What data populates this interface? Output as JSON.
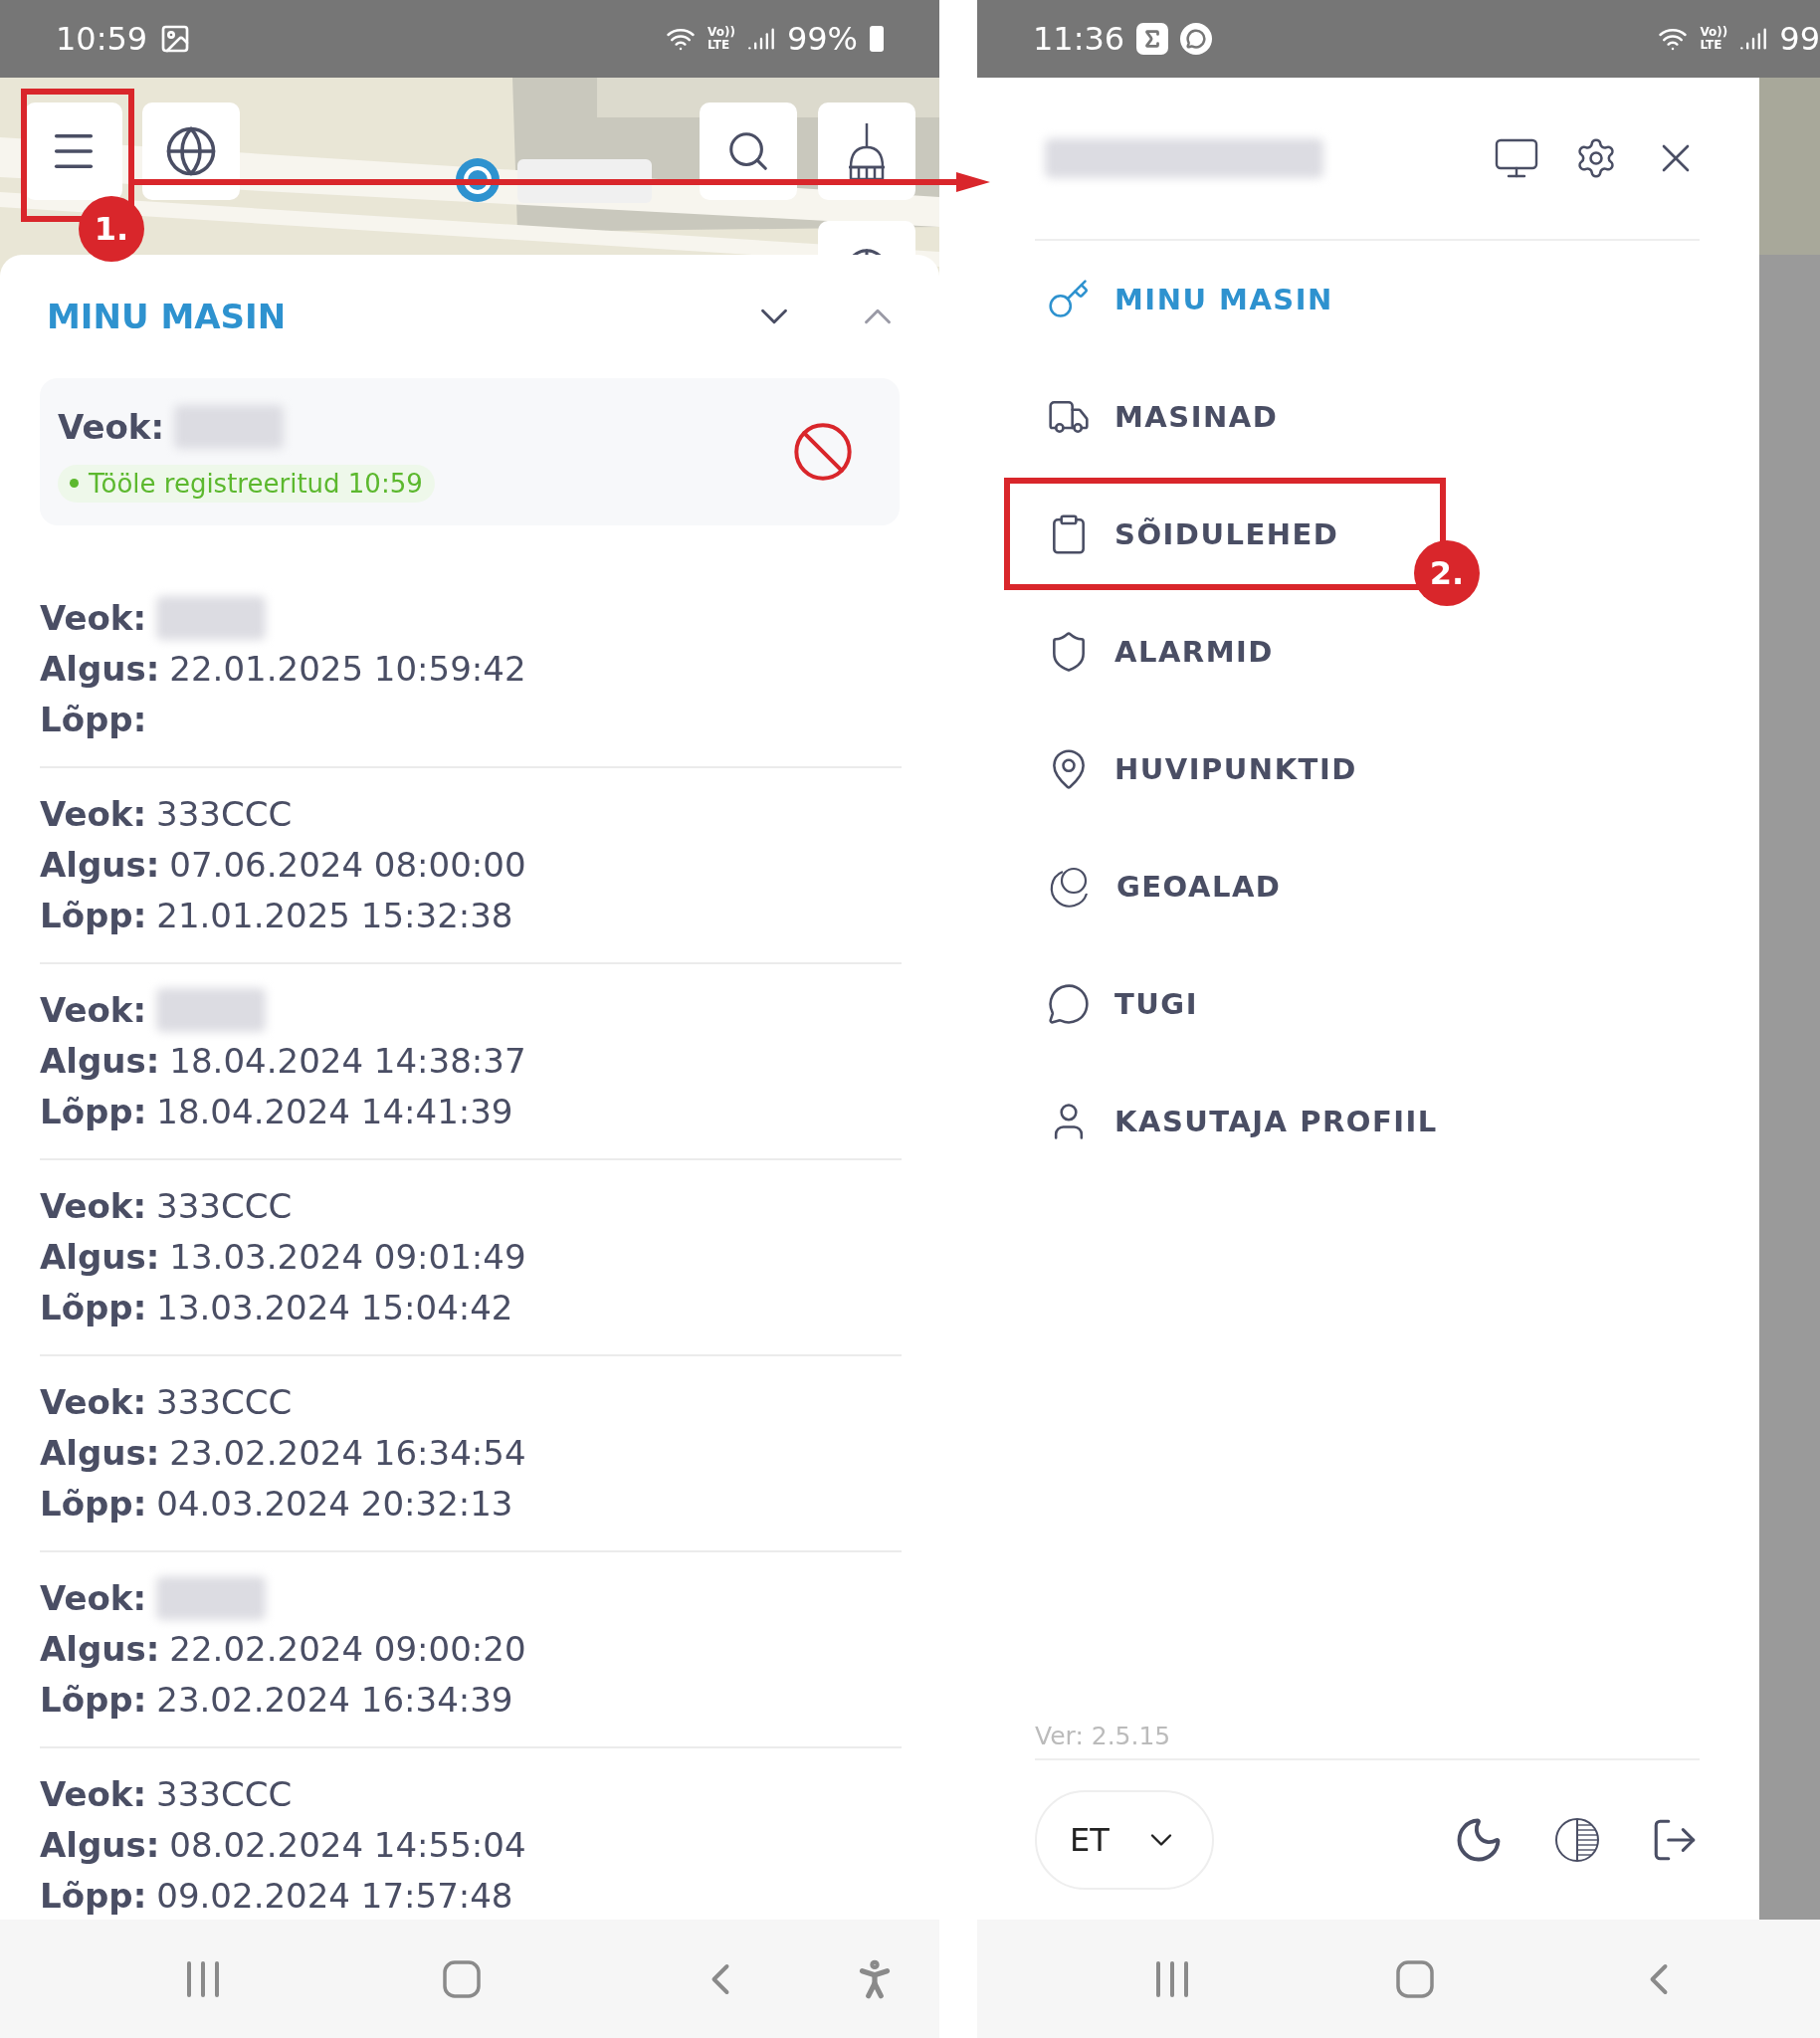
{
  "annotations": [
    {
      "label": "1."
    },
    {
      "label": "2."
    }
  ],
  "left_phone": {
    "status_bar": {
      "time": "10:59",
      "volte_top": "Vo))",
      "volte_bottom": "LTE",
      "battery": "99%"
    },
    "panel": {
      "title": "MINU MASIN",
      "current": {
        "label": "Veok:",
        "redacted": true,
        "status": "Tööle registreeritud 10:59"
      },
      "entries": [
        {
          "vehicle_label": "Veok:",
          "vehicle_redacted": true,
          "start_label": "Algus:",
          "start": "22.01.2025 10:59:42",
          "end_label": "Lõpp:"
        },
        {
          "vehicle_label": "Veok:",
          "vehicle": "333CCC",
          "vehicle_redacted": false,
          "start_label": "Algus:",
          "start": "07.06.2024 08:00:00",
          "end_label": "Lõpp:",
          "end": "21.01.2025 15:32:38"
        },
        {
          "vehicle_label": "Veok:",
          "vehicle_redacted": true,
          "start_label": "Algus:",
          "start": "18.04.2024 14:38:37",
          "end_label": "Lõpp:",
          "end": "18.04.2024 14:41:39"
        },
        {
          "vehicle_label": "Veok:",
          "vehicle": "333CCC",
          "vehicle_redacted": false,
          "start_label": "Algus:",
          "start": "13.03.2024 09:01:49",
          "end_label": "Lõpp:",
          "end": "13.03.2024 15:04:42"
        },
        {
          "vehicle_label": "Veok:",
          "vehicle": "333CCC",
          "vehicle_redacted": false,
          "start_label": "Algus:",
          "start": "23.02.2024 16:34:54",
          "end_label": "Lõpp:",
          "end": "04.03.2024 20:32:13"
        },
        {
          "vehicle_label": "Veok:",
          "vehicle_redacted": true,
          "start_label": "Algus:",
          "start": "22.02.2024 09:00:20",
          "end_label": "Lõpp:",
          "end": "23.02.2024 16:34:39"
        },
        {
          "vehicle_label": "Veok:",
          "vehicle": "333CCC",
          "vehicle_redacted": false,
          "start_label": "Algus:",
          "start": "08.02.2024 14:55:04",
          "end_label": "Lõpp:",
          "end": "09.02.2024 17:57:48"
        }
      ]
    }
  },
  "right_phone": {
    "status_bar": {
      "time": "11:36",
      "volte_top": "Vo))",
      "volte_bottom": "LTE",
      "battery": "99"
    },
    "drawer": {
      "user_redacted": true,
      "items": [
        {
          "label": "MINU MASIN",
          "selected": true
        },
        {
          "label": "MASINAD",
          "selected": false
        },
        {
          "label": "SÕIDULEHED",
          "selected": false
        },
        {
          "label": "ALARMID",
          "selected": false
        },
        {
          "label": "HUVIPUNKTID",
          "selected": false
        },
        {
          "label": "GEOALAD",
          "selected": false
        },
        {
          "label": "TUGI",
          "selected": false
        },
        {
          "label": "KASUTAJA PROFIIL",
          "selected": false
        }
      ],
      "version": "Ver: 2.5.15",
      "language": "ET"
    }
  }
}
